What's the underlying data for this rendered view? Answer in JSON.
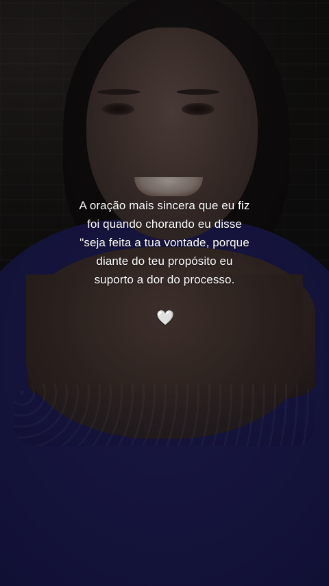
{
  "story": {
    "caption_lines": [
      "A oração mais sincera que eu fiz",
      "foi quando chorando eu disse",
      "\"seja feita a tua vontade, porque",
      "diante do teu propósito eu",
      "suporto a dor do processo."
    ],
    "emoji": "🤍",
    "emoji_name": "white-heart-icon"
  },
  "colors": {
    "caption_text": "#ffffff",
    "shirt_blue": "#1f1d58",
    "background_dark": "#121216"
  }
}
